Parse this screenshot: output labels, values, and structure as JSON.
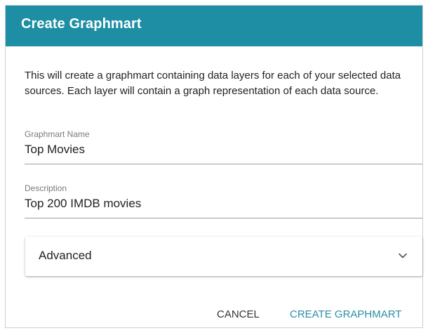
{
  "dialog": {
    "title": "Create Graphmart",
    "intro": "This will create a graphmart containing data layers for each of your selected data sources. Each layer will contain a graph representation of each data source.",
    "header_color": "#1d8ea3"
  },
  "fields": {
    "name": {
      "label": "Graphmart Name",
      "value": "Top Movies"
    },
    "description": {
      "label": "Description",
      "value": "Top 200 IMDB movies"
    }
  },
  "advanced": {
    "label": "Advanced",
    "icon": "chevron-down-icon"
  },
  "actions": {
    "cancel_label": "CANCEL",
    "create_label": "CREATE GRAPHMART",
    "primary_color": "#2a8fa5"
  }
}
